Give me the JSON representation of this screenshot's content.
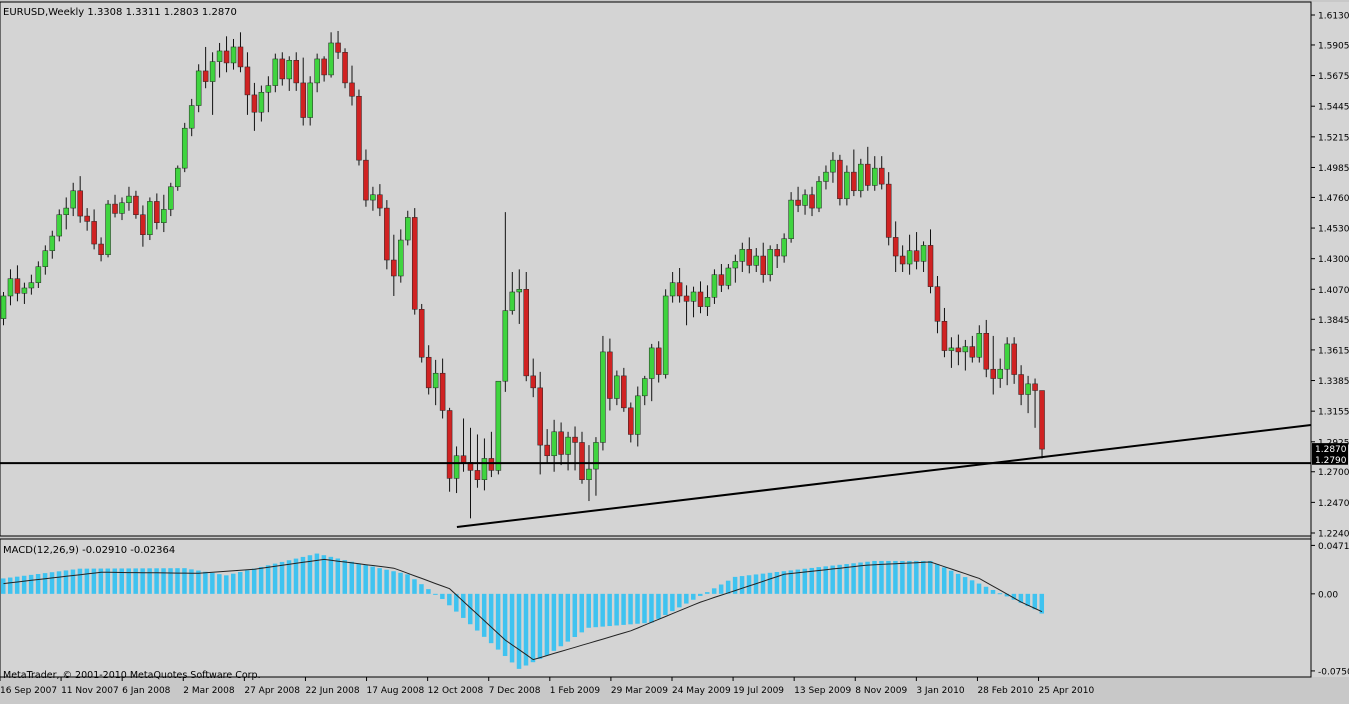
{
  "colors": {
    "background": "#d4d4d4",
    "bull": "#3fd43f",
    "bear": "#d02222",
    "macd_hist": "#3fc3f0",
    "signal_line": "#222222",
    "trendline": "#000000",
    "price_tag": "#000000"
  },
  "chart_data": [
    {
      "type": "candlestick",
      "header": "EURUSD,Weekly  1.3308 1.3311 1.2803 1.2870",
      "symbol": "EURUSD",
      "timeframe": "Weekly",
      "ohlc_header": {
        "open": 1.3308,
        "high": 1.3311,
        "low": 1.2803,
        "close": 1.287
      },
      "ylim": [
        1.224,
        1.613
      ],
      "y_ticks": [
        "1.6130",
        "1.5905",
        "1.5675",
        "1.5445",
        "1.5215",
        "1.4985",
        "1.4760",
        "1.4530",
        "1.4300",
        "1.4070",
        "1.3845",
        "1.3615",
        "1.3385",
        "1.3155",
        "1.2925",
        "1.2700",
        "1.2470",
        "1.2240"
      ],
      "price_tags": [
        "1.2870",
        "1.2790"
      ],
      "x_labels": [
        "16 Sep 2007",
        "11 Nov 2007",
        "6 Jan 2008",
        "2 Mar 2008",
        "27 Apr 2008",
        "22 Jun 2008",
        "17 Aug 2008",
        "12 Oct 2008",
        "7 Dec 2008",
        "1 Feb 2009",
        "29 Mar 2009",
        "24 May 2009",
        "19 Jul 2009",
        "13 Sep 2009",
        "8 Nov 2009",
        "3 Jan 2010",
        "28 Feb 2010",
        "25 Apr 2010"
      ],
      "candles": [
        [
          1.385,
          1.405,
          1.38,
          1.402
        ],
        [
          1.402,
          1.422,
          1.395,
          1.415
        ],
        [
          1.415,
          1.425,
          1.398,
          1.404
        ],
        [
          1.404,
          1.412,
          1.396,
          1.408
        ],
        [
          1.408,
          1.418,
          1.403,
          1.412
        ],
        [
          1.412,
          1.428,
          1.408,
          1.424
        ],
        [
          1.424,
          1.44,
          1.418,
          1.436
        ],
        [
          1.436,
          1.451,
          1.43,
          1.447
        ],
        [
          1.447,
          1.467,
          1.443,
          1.463
        ],
        [
          1.463,
          1.476,
          1.452,
          1.468
        ],
        [
          1.468,
          1.487,
          1.462,
          1.481
        ],
        [
          1.481,
          1.492,
          1.457,
          1.462
        ],
        [
          1.462,
          1.468,
          1.451,
          1.458
        ],
        [
          1.458,
          1.467,
          1.437,
          1.441
        ],
        [
          1.441,
          1.446,
          1.428,
          1.433
        ],
        [
          1.433,
          1.474,
          1.431,
          1.471
        ],
        [
          1.471,
          1.478,
          1.461,
          1.464
        ],
        [
          1.464,
          1.476,
          1.459,
          1.472
        ],
        [
          1.472,
          1.484,
          1.466,
          1.477
        ],
        [
          1.477,
          1.481,
          1.46,
          1.463
        ],
        [
          1.463,
          1.47,
          1.439,
          1.448
        ],
        [
          1.448,
          1.476,
          1.444,
          1.473
        ],
        [
          1.473,
          1.479,
          1.452,
          1.457
        ],
        [
          1.457,
          1.478,
          1.45,
          1.467
        ],
        [
          1.467,
          1.487,
          1.462,
          1.484
        ],
        [
          1.484,
          1.5,
          1.481,
          1.498
        ],
        [
          1.498,
          1.532,
          1.495,
          1.528
        ],
        [
          1.528,
          1.55,
          1.522,
          1.545
        ],
        [
          1.545,
          1.576,
          1.54,
          1.571
        ],
        [
          1.571,
          1.589,
          1.558,
          1.563
        ],
        [
          1.563,
          1.585,
          1.538,
          1.578
        ],
        [
          1.578,
          1.592,
          1.566,
          1.586
        ],
        [
          1.586,
          1.597,
          1.57,
          1.577
        ],
        [
          1.577,
          1.595,
          1.572,
          1.589
        ],
        [
          1.589,
          1.6,
          1.57,
          1.574
        ],
        [
          1.574,
          1.585,
          1.538,
          1.553
        ],
        [
          1.553,
          1.562,
          1.526,
          1.54
        ],
        [
          1.54,
          1.56,
          1.533,
          1.555
        ],
        [
          1.555,
          1.567,
          1.54,
          1.56
        ],
        [
          1.56,
          1.584,
          1.555,
          1.58
        ],
        [
          1.58,
          1.585,
          1.56,
          1.565
        ],
        [
          1.565,
          1.582,
          1.556,
          1.579
        ],
        [
          1.579,
          1.585,
          1.556,
          1.562
        ],
        [
          1.562,
          1.581,
          1.53,
          1.536
        ],
        [
          1.536,
          1.567,
          1.53,
          1.562
        ],
        [
          1.562,
          1.584,
          1.555,
          1.58
        ],
        [
          1.58,
          1.582,
          1.563,
          1.568
        ],
        [
          1.568,
          1.6,
          1.566,
          1.592
        ],
        [
          1.592,
          1.601,
          1.58,
          1.585
        ],
        [
          1.585,
          1.588,
          1.558,
          1.562
        ],
        [
          1.562,
          1.575,
          1.545,
          1.552
        ],
        [
          1.552,
          1.557,
          1.5,
          1.504
        ],
        [
          1.504,
          1.512,
          1.469,
          1.474
        ],
        [
          1.474,
          1.484,
          1.466,
          1.478
        ],
        [
          1.478,
          1.486,
          1.462,
          1.468
        ],
        [
          1.468,
          1.474,
          1.422,
          1.429
        ],
        [
          1.429,
          1.448,
          1.402,
          1.417
        ],
        [
          1.417,
          1.452,
          1.412,
          1.444
        ],
        [
          1.444,
          1.466,
          1.44,
          1.461
        ],
        [
          1.461,
          1.468,
          1.388,
          1.392
        ],
        [
          1.392,
          1.396,
          1.352,
          1.356
        ],
        [
          1.356,
          1.365,
          1.328,
          1.333
        ],
        [
          1.333,
          1.354,
          1.32,
          1.344
        ],
        [
          1.344,
          1.355,
          1.31,
          1.316
        ],
        [
          1.316,
          1.318,
          1.255,
          1.265
        ],
        [
          1.265,
          1.289,
          1.254,
          1.282
        ],
        [
          1.282,
          1.31,
          1.27,
          1.277
        ],
        [
          1.277,
          1.303,
          1.235,
          1.271
        ],
        [
          1.271,
          1.298,
          1.258,
          1.264
        ],
        [
          1.264,
          1.295,
          1.256,
          1.28
        ],
        [
          1.28,
          1.3,
          1.266,
          1.271
        ],
        [
          1.271,
          1.33,
          1.268,
          1.338
        ],
        [
          1.338,
          1.465,
          1.33,
          1.391
        ],
        [
          1.391,
          1.42,
          1.388,
          1.405
        ],
        [
          1.405,
          1.422,
          1.381,
          1.407
        ],
        [
          1.407,
          1.42,
          1.338,
          1.342
        ],
        [
          1.342,
          1.355,
          1.326,
          1.333
        ],
        [
          1.333,
          1.345,
          1.268,
          1.29
        ],
        [
          1.29,
          1.302,
          1.276,
          1.282
        ],
        [
          1.282,
          1.309,
          1.27,
          1.3
        ],
        [
          1.3,
          1.307,
          1.275,
          1.283
        ],
        [
          1.283,
          1.3,
          1.271,
          1.296
        ],
        [
          1.296,
          1.304,
          1.271,
          1.292
        ],
        [
          1.292,
          1.3,
          1.261,
          1.264
        ],
        [
          1.264,
          1.29,
          1.248,
          1.272
        ],
        [
          1.272,
          1.296,
          1.252,
          1.292
        ],
        [
          1.292,
          1.372,
          1.286,
          1.36
        ],
        [
          1.36,
          1.37,
          1.316,
          1.325
        ],
        [
          1.325,
          1.346,
          1.32,
          1.342
        ],
        [
          1.342,
          1.348,
          1.315,
          1.318
        ],
        [
          1.318,
          1.322,
          1.292,
          1.298
        ],
        [
          1.298,
          1.334,
          1.289,
          1.327
        ],
        [
          1.327,
          1.342,
          1.32,
          1.34
        ],
        [
          1.34,
          1.366,
          1.323,
          1.363
        ],
        [
          1.363,
          1.368,
          1.337,
          1.343
        ],
        [
          1.343,
          1.407,
          1.34,
          1.402
        ],
        [
          1.402,
          1.42,
          1.397,
          1.412
        ],
        [
          1.412,
          1.423,
          1.397,
          1.402
        ],
        [
          1.402,
          1.41,
          1.38,
          1.398
        ],
        [
          1.398,
          1.409,
          1.386,
          1.405
        ],
        [
          1.405,
          1.413,
          1.389,
          1.394
        ],
        [
          1.394,
          1.41,
          1.387,
          1.401
        ],
        [
          1.401,
          1.422,
          1.396,
          1.418
        ],
        [
          1.418,
          1.426,
          1.405,
          1.41
        ],
        [
          1.41,
          1.426,
          1.407,
          1.423
        ],
        [
          1.423,
          1.433,
          1.412,
          1.428
        ],
        [
          1.428,
          1.442,
          1.42,
          1.437
        ],
        [
          1.437,
          1.446,
          1.419,
          1.425
        ],
        [
          1.425,
          1.438,
          1.42,
          1.432
        ],
        [
          1.432,
          1.442,
          1.412,
          1.418
        ],
        [
          1.418,
          1.44,
          1.413,
          1.437
        ],
        [
          1.437,
          1.441,
          1.423,
          1.432
        ],
        [
          1.432,
          1.449,
          1.427,
          1.445
        ],
        [
          1.445,
          1.48,
          1.442,
          1.474
        ],
        [
          1.474,
          1.484,
          1.465,
          1.47
        ],
        [
          1.47,
          1.482,
          1.463,
          1.478
        ],
        [
          1.478,
          1.484,
          1.462,
          1.468
        ],
        [
          1.468,
          1.492,
          1.465,
          1.488
        ],
        [
          1.488,
          1.5,
          1.482,
          1.495
        ],
        [
          1.495,
          1.51,
          1.487,
          1.504
        ],
        [
          1.504,
          1.508,
          1.47,
          1.475
        ],
        [
          1.475,
          1.5,
          1.47,
          1.495
        ],
        [
          1.495,
          1.512,
          1.477,
          1.481
        ],
        [
          1.481,
          1.505,
          1.476,
          1.501
        ],
        [
          1.501,
          1.514,
          1.481,
          1.485
        ],
        [
          1.485,
          1.507,
          1.481,
          1.498
        ],
        [
          1.498,
          1.507,
          1.482,
          1.486
        ],
        [
          1.486,
          1.495,
          1.44,
          1.446
        ],
        [
          1.446,
          1.458,
          1.42,
          1.432
        ],
        [
          1.432,
          1.44,
          1.42,
          1.426
        ],
        [
          1.426,
          1.448,
          1.418,
          1.436
        ],
        [
          1.436,
          1.45,
          1.422,
          1.428
        ],
        [
          1.428,
          1.443,
          1.42,
          1.44
        ],
        [
          1.44,
          1.452,
          1.404,
          1.409
        ],
        [
          1.409,
          1.417,
          1.374,
          1.383
        ],
        [
          1.383,
          1.393,
          1.356,
          1.361
        ],
        [
          1.361,
          1.371,
          1.348,
          1.363
        ],
        [
          1.363,
          1.373,
          1.35,
          1.36
        ],
        [
          1.36,
          1.369,
          1.346,
          1.364
        ],
        [
          1.364,
          1.372,
          1.352,
          1.356
        ],
        [
          1.356,
          1.38,
          1.352,
          1.374
        ],
        [
          1.374,
          1.384,
          1.341,
          1.347
        ],
        [
          1.347,
          1.372,
          1.328,
          1.34
        ],
        [
          1.34,
          1.355,
          1.333,
          1.347
        ],
        [
          1.347,
          1.371,
          1.335,
          1.366
        ],
        [
          1.366,
          1.371,
          1.336,
          1.343
        ],
        [
          1.343,
          1.35,
          1.32,
          1.328
        ],
        [
          1.328,
          1.342,
          1.314,
          1.336
        ],
        [
          1.336,
          1.34,
          1.303,
          1.331
        ],
        [
          1.331,
          1.331,
          1.28,
          1.287
        ]
      ],
      "trendlines": [
        {
          "from": [
            "12 Oct 2008",
            1.2285
          ],
          "to": [
            "25 Apr 2010",
            1.281
          ],
          "extends": "right"
        },
        {
          "horizontal": 1.2765
        }
      ]
    },
    {
      "type": "histogram",
      "label": "MACD(12,26,9) -0.02910 -0.02364",
      "name": "MACD",
      "params": [
        12,
        26,
        9
      ],
      "values_header": [
        -0.0291,
        -0.02364
      ],
      "ylim": [
        -0.078,
        0.0485
      ],
      "y_ticks": [
        "0.04713",
        "0.00",
        "-0.0750"
      ],
      "histogram_points": [
        [
          0,
          0.015
        ],
        [
          11,
          0.0245
        ],
        [
          26,
          0.025
        ],
        [
          32,
          0.018
        ],
        [
          45,
          0.0392
        ],
        [
          52,
          0.028
        ],
        [
          58,
          0.019
        ],
        [
          63,
          -0.005
        ],
        [
          70,
          -0.048
        ],
        [
          74,
          -0.073
        ],
        [
          78,
          -0.06
        ],
        [
          84,
          -0.033
        ],
        [
          93,
          -0.028
        ],
        [
          105,
          0.0165
        ],
        [
          117,
          0.026
        ],
        [
          125,
          0.032
        ],
        [
          133,
          0.032
        ],
        [
          140,
          0.01
        ],
        [
          148,
          -0.015
        ],
        [
          151,
          -0.0275
        ]
      ],
      "signal_points": [
        [
          0,
          0.01
        ],
        [
          14,
          0.021
        ],
        [
          28,
          0.02
        ],
        [
          36,
          0.024
        ],
        [
          46,
          0.0335
        ],
        [
          56,
          0.025
        ],
        [
          64,
          0.005
        ],
        [
          72,
          -0.045
        ],
        [
          76,
          -0.064
        ],
        [
          80,
          -0.056
        ],
        [
          90,
          -0.036
        ],
        [
          100,
          -0.008
        ],
        [
          112,
          0.019
        ],
        [
          124,
          0.028
        ],
        [
          133,
          0.031
        ],
        [
          140,
          0.015
        ],
        [
          146,
          -0.008
        ],
        [
          151,
          -0.0236
        ]
      ]
    }
  ],
  "footer": "MetaTrader, © 2001-2010 MetaQuotes Software Corp."
}
